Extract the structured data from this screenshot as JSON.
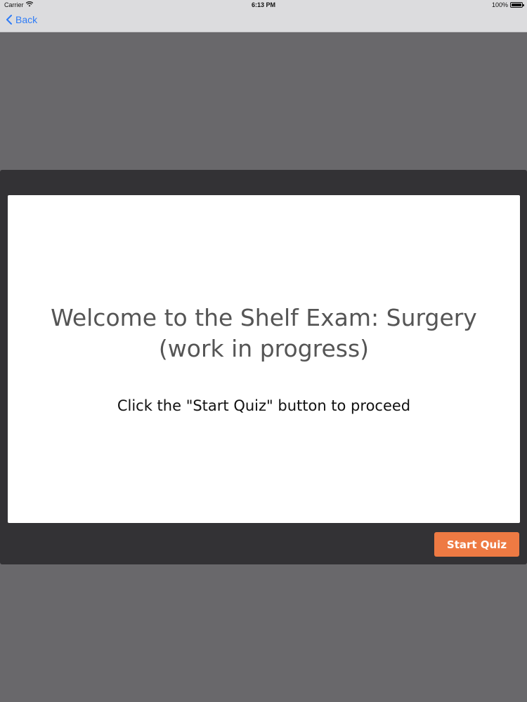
{
  "status_bar": {
    "carrier": "Carrier",
    "time": "6:13 PM",
    "battery": "100%",
    "battery_level": 1.0,
    "wifi_icon": "wifi-icon",
    "battery_icon": "battery-icon"
  },
  "nav": {
    "back_label": "Back",
    "back_icon": "chevron-left-icon"
  },
  "quiz": {
    "title_line1": "Welcome to the Shelf Exam: Surgery",
    "title_line2": "(work in progress)",
    "instruction": "Click the \"Start Quiz\" button to proceed",
    "start_button_label": "Start Quiz"
  },
  "colors": {
    "background": "#69686b",
    "frame": "#333235",
    "accent": "#ee7a43",
    "link": "#2f7cf6",
    "title_text": "#555555"
  }
}
